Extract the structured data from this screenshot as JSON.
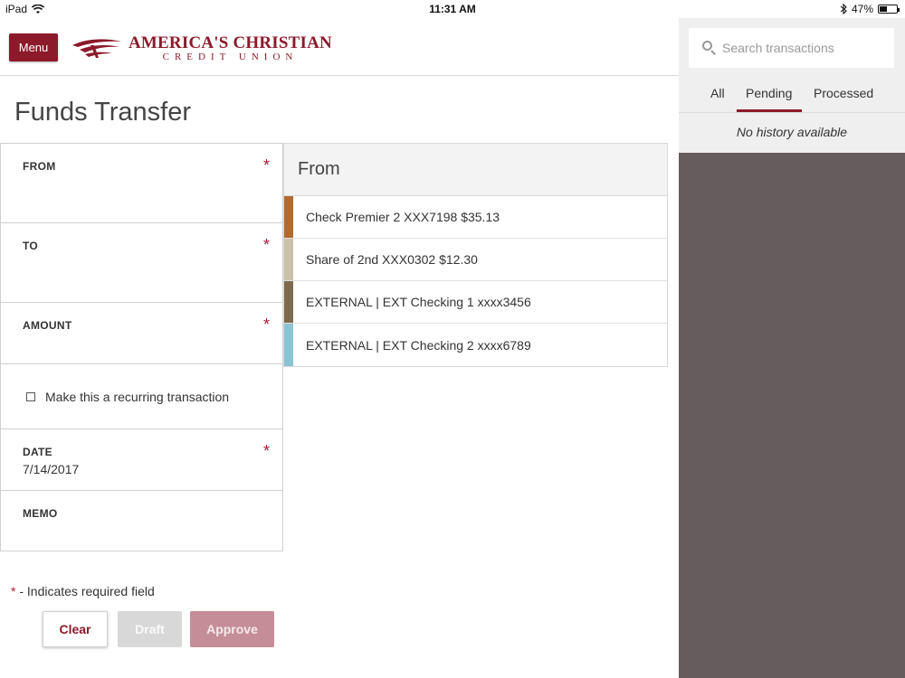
{
  "status_bar": {
    "device": "iPad",
    "time": "11:31 AM",
    "battery": "47%",
    "battery_level": 0.47,
    "wifi_icon": "wifi-icon",
    "bluetooth_icon": "bluetooth-icon"
  },
  "header": {
    "menu_label": "Menu",
    "logo_line1": "AMERICA'S CHRISTIAN",
    "logo_line2": "CREDIT UNION"
  },
  "page": {
    "title": "Funds Transfer"
  },
  "form": {
    "from_label": "FROM",
    "to_label": "TO",
    "amount_label": "AMOUNT",
    "recurring_label": "Make this a recurring transaction",
    "date_label": "DATE",
    "date_value": "7/14/2017",
    "memo_label": "MEMO",
    "required_mark": "*",
    "required_note": " - Indicates required field"
  },
  "buttons": {
    "clear": "Clear",
    "draft": "Draft",
    "approve": "Approve"
  },
  "dropdown": {
    "title": "From",
    "items": [
      {
        "label": "Check Premier 2 XXX7198 $35.13",
        "color": "#b26a2e"
      },
      {
        "label": "Share of 2nd XXX0302 $12.30",
        "color": "#cbc0a8"
      },
      {
        "label": "EXTERNAL | EXT Checking 1 xxxx3456",
        "color": "#7d6a4c"
      },
      {
        "label": "EXTERNAL | EXT Checking 2 xxxx6789",
        "color": "#8ac3d4"
      }
    ]
  },
  "sidebar": {
    "search_placeholder": "Search transactions",
    "tabs": [
      "All",
      "Pending",
      "Processed"
    ],
    "active_tab": "Pending",
    "empty_message": "No history available"
  },
  "colors": {
    "brand": "#8c1a2a",
    "required": "#b01a35",
    "sidebar_bg": "#655c5e"
  }
}
